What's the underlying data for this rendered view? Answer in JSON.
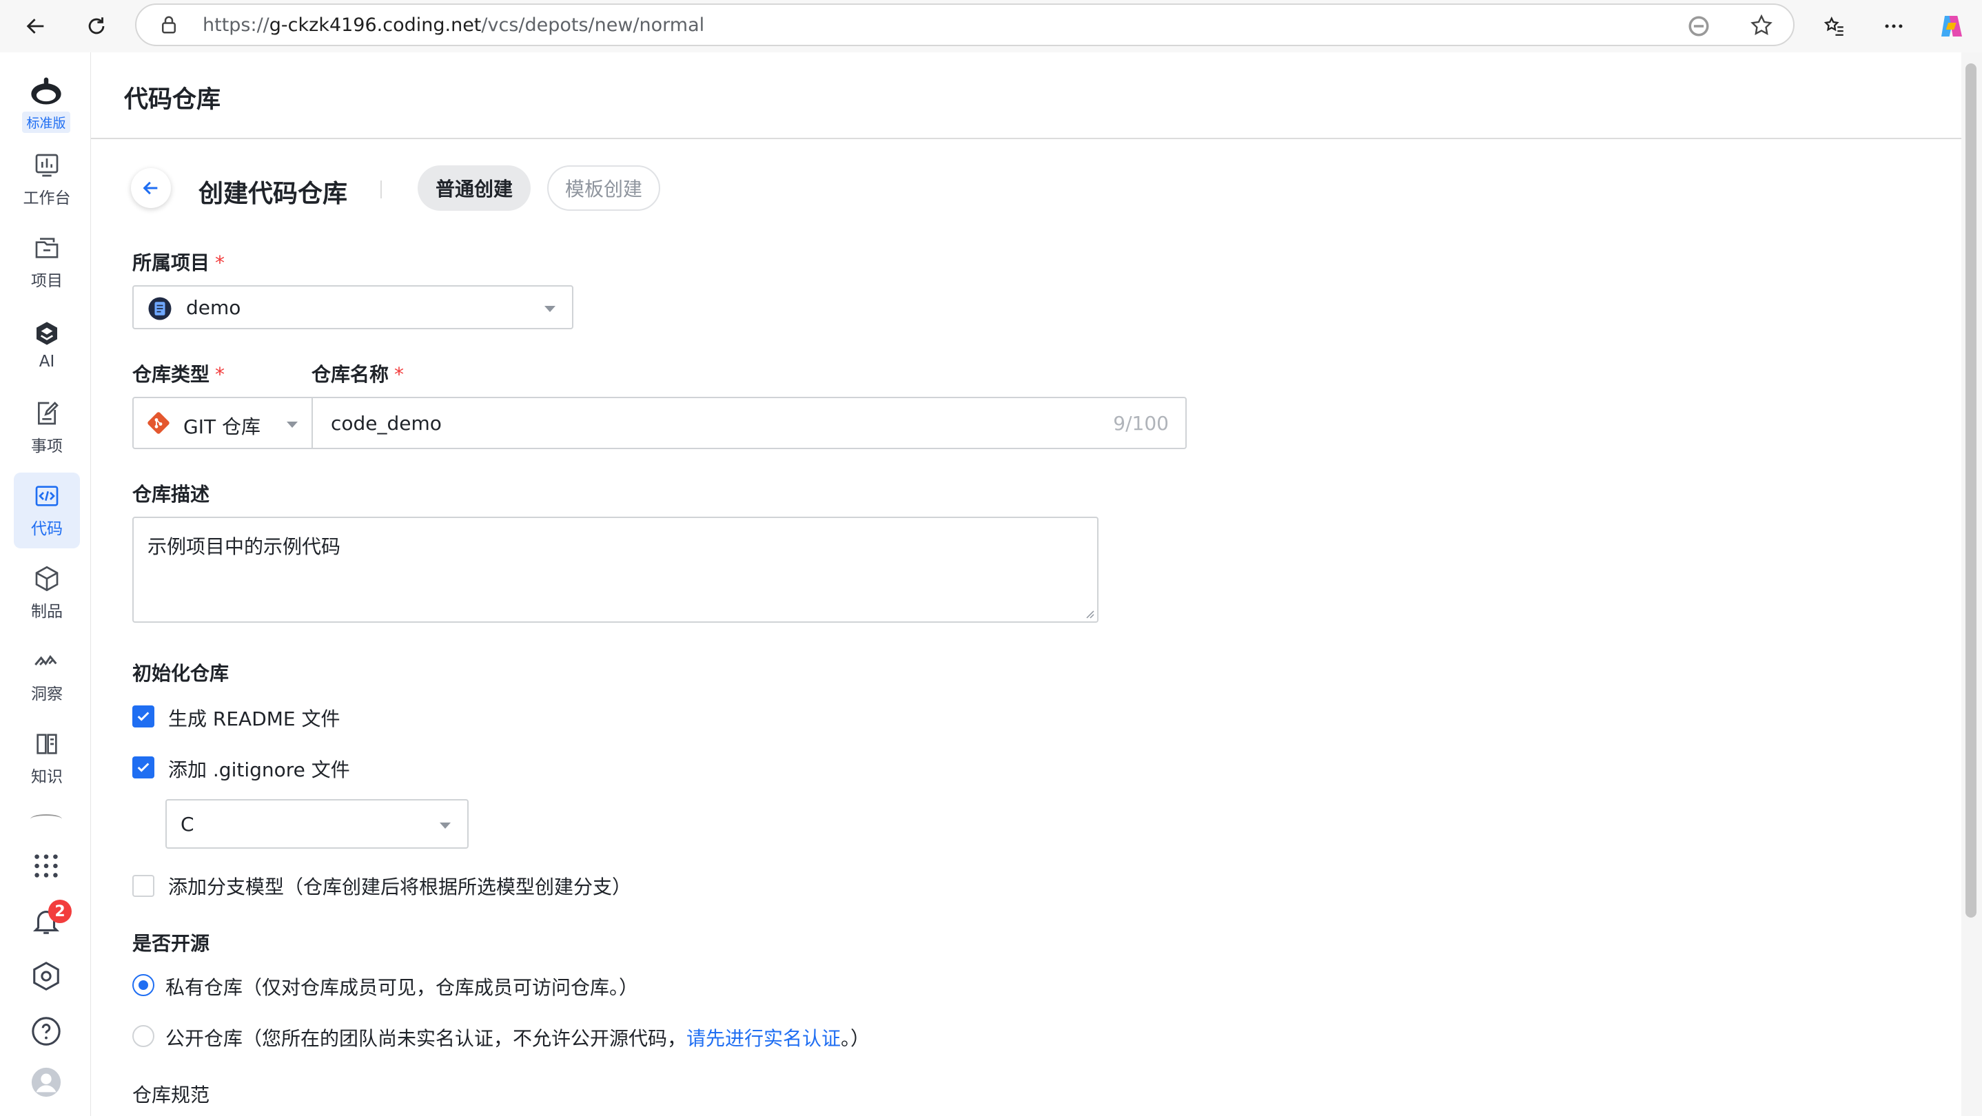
{
  "browser": {
    "url_prefix": "https://",
    "url_host": "g-ckzk4196.coding.net",
    "url_path": "/vcs/depots/new/normal"
  },
  "sidebar": {
    "edition_badge": "标准版",
    "items": [
      {
        "label": "工作台",
        "icon": "dashboard-icon"
      },
      {
        "label": "项目",
        "icon": "folder-icon"
      },
      {
        "label": "AI",
        "icon": "ai-icon"
      },
      {
        "label": "事项",
        "icon": "task-icon"
      },
      {
        "label": "代码",
        "icon": "code-icon",
        "active": true
      },
      {
        "label": "制品",
        "icon": "box-icon"
      },
      {
        "label": "洞察",
        "icon": "insight-icon"
      },
      {
        "label": "知识",
        "icon": "book-icon"
      }
    ],
    "notification_count": "2"
  },
  "header": {
    "title": "代码仓库"
  },
  "page": {
    "title": "创建代码仓库",
    "tabs": [
      {
        "label": "普通创建",
        "active": true
      },
      {
        "label": "模板创建",
        "active": false
      }
    ]
  },
  "form": {
    "project_label": "所属项目",
    "project_value": "demo",
    "repo_type_label": "仓库类型",
    "repo_type_value": "GIT 仓库",
    "repo_name_label": "仓库名称",
    "repo_name_value": "code_demo",
    "repo_name_count": "9/100",
    "desc_label": "仓库描述",
    "desc_value": "示例项目中的示例代码",
    "init_label": "初始化仓库",
    "readme_label": "生成 README 文件",
    "readme_checked": true,
    "gitignore_label": "添加 .gitignore 文件",
    "gitignore_checked": true,
    "gitignore_value": "C",
    "branch_model_label": "添加分支模型（仓库创建后将根据所选模型创建分支）",
    "branch_model_checked": false,
    "opensource_label": "是否开源",
    "private_label": "私有仓库（仅对仓库成员可见，仓库成员可访问仓库。）",
    "public_label_pre": "公开仓库（您所在的团队尚未实名认证，不允许公开源代码，",
    "public_link": "请先进行实名认证",
    "public_label_post": "。）",
    "visibility": "private",
    "spec_label": "仓库规范"
  },
  "colors": {
    "accent": "#1f6ef2",
    "required": "#f23d3d",
    "git": "#e4572e"
  }
}
